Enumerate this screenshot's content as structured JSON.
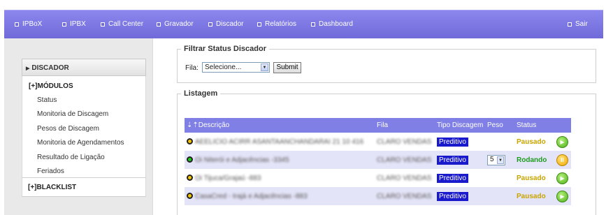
{
  "nav": {
    "items": [
      {
        "label": "IPBoX"
      },
      {
        "label": "IPBX"
      },
      {
        "label": "Call Center"
      },
      {
        "label": "Gravador"
      },
      {
        "label": "Discador"
      },
      {
        "label": "Relatórios"
      },
      {
        "label": "Dashboard"
      }
    ],
    "logout": "Sair"
  },
  "sidebar": {
    "title": "DISCADOR",
    "modules_label": "[+]MÓDULOS",
    "links": [
      {
        "label": "Status"
      },
      {
        "label": "Monitoria de Discagem"
      },
      {
        "label": "Pesos de Discagem"
      },
      {
        "label": "Monitoria de Agendamentos"
      },
      {
        "label": "Resultado de Ligação"
      },
      {
        "label": "Feriados"
      }
    ],
    "blacklist_label": "[+]BLACKLIST"
  },
  "filter": {
    "legend": "Filtrar Status Discador",
    "fila_label": "Fila:",
    "select_value": "Selecione...",
    "submit_label": "Submit"
  },
  "listing": {
    "legend": "Listagem",
    "headers": {
      "sort": "⇣⇡",
      "descricao": "Descrição",
      "fila": "Fila",
      "tipo": "Tipo Discagem",
      "peso": "Peso",
      "status": "Status"
    },
    "rows": [
      {
        "dot": "#f5c400",
        "descricao": "AEELICIO ACIRR ASANTAANCHANDARAI 21 10 416",
        "fila": "CLARO VENDAS",
        "tipo": "Preditivo",
        "peso": "",
        "status": "Pausado",
        "action": "play"
      },
      {
        "dot": "#1ec81e",
        "descricao": "Oi Niterói e Adjacências -3345",
        "fila": "CLARO VENDAS",
        "tipo": "Preditivo",
        "peso": "5",
        "status": "Rodando",
        "action": "pause"
      },
      {
        "dot": "#f5c400",
        "descricao": "Oi Tijuca/Grajaú -883",
        "fila": "CLARO VENDAS",
        "tipo": "Preditivo",
        "peso": "",
        "status": "Pausado",
        "action": "play"
      },
      {
        "dot": "#f5c400",
        "descricao": "CasaCred - Irajá e Adjacências -883",
        "fila": "CLARO VENDAS",
        "tipo": "Preditivo",
        "peso": "",
        "status": "Pausado",
        "action": "play"
      }
    ]
  },
  "colors": {
    "nav_bar": "#7a75e0",
    "table_header": "#7f7fe6",
    "tipo_badge": "#1a1acd",
    "paused": "#c8a400",
    "running": "#1e9a1e"
  }
}
